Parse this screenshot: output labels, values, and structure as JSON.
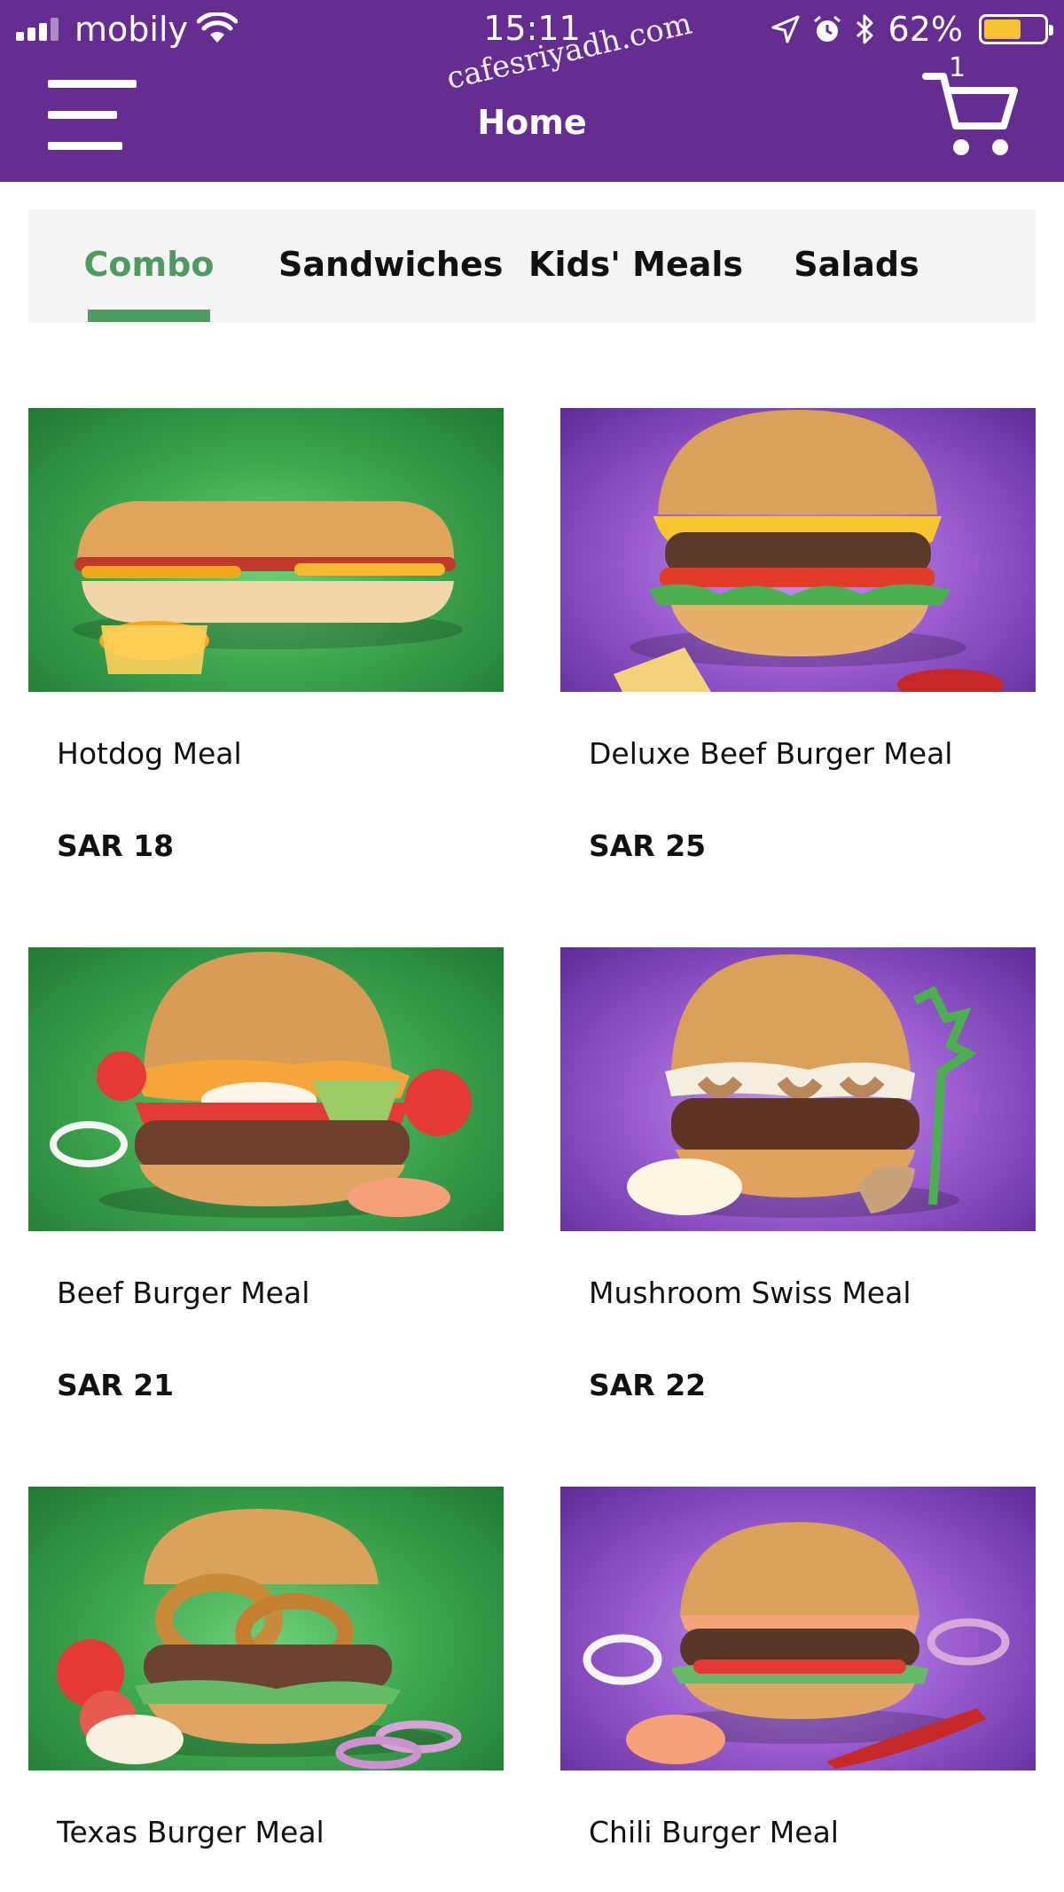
{
  "status_bar": {
    "carrier": "mobily",
    "time": "15:11",
    "battery_percent": "62%",
    "battery_level": 0.62,
    "icons": [
      "signal-icon",
      "wifi-icon",
      "location-arrow-icon",
      "alarm-icon",
      "bluetooth-icon",
      "battery-icon"
    ]
  },
  "header": {
    "title": "Home",
    "watermark": "cafesriyadh.com",
    "cart_count": "1",
    "colors": {
      "primary": "#662d91",
      "accent": "#4f9a60"
    }
  },
  "tabs": [
    {
      "label": "Combo",
      "active": true
    },
    {
      "label": "Sandwiches",
      "active": false
    },
    {
      "label": "Kids' Meals",
      "active": false
    },
    {
      "label": "Salads",
      "active": false
    }
  ],
  "products": [
    {
      "name": "Hotdog Meal",
      "price": "SAR 18",
      "background": "green"
    },
    {
      "name": "Deluxe Beef Burger Meal",
      "price": "SAR 25",
      "background": "purple"
    },
    {
      "name": "Beef Burger Meal",
      "price": "SAR 21",
      "background": "green"
    },
    {
      "name": "Mushroom Swiss Meal",
      "price": "SAR 22",
      "background": "purple"
    },
    {
      "name": "Texas Burger Meal",
      "price": "",
      "background": "green"
    },
    {
      "name": "Chili Burger Meal",
      "price": "",
      "background": "purple"
    }
  ]
}
